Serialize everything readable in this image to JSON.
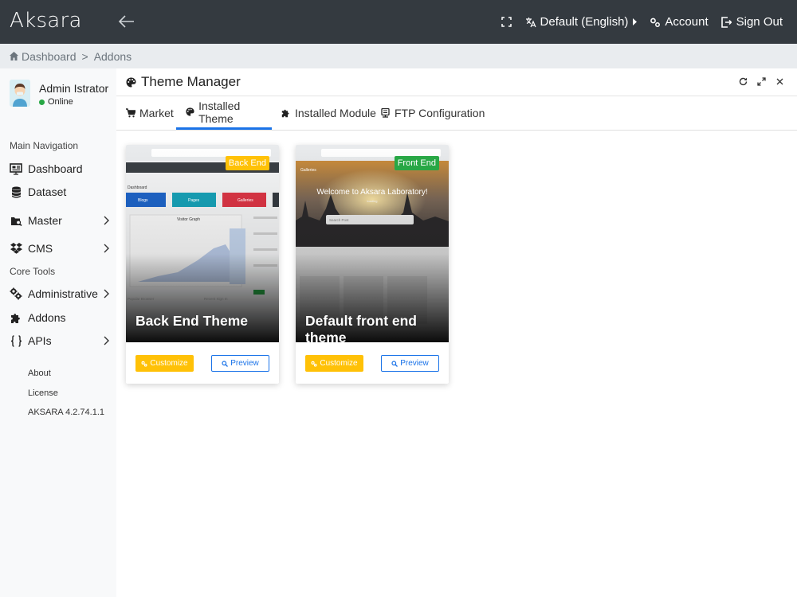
{
  "app": {
    "brand": "Aksara"
  },
  "topbar": {
    "language": "Default (English)",
    "account": "Account",
    "signout": "Sign Out"
  },
  "breadcrumb": {
    "items": [
      "Dashboard",
      "Addons"
    ]
  },
  "user": {
    "name": "Admin Istrator",
    "status": "Online"
  },
  "sidebar": {
    "main_header": "Main Navigation",
    "core_header": "Core Tools",
    "items": {
      "dashboard": "Dashboard",
      "dataset": "Dataset",
      "master": "Master",
      "cms": "CMS",
      "administrative": "Administrative",
      "addons": "Addons",
      "apis": "APIs"
    },
    "footer": {
      "about": "About",
      "license": "License",
      "version": "AKSARA 4.2.74.1.1"
    }
  },
  "panel": {
    "title": "Theme Manager"
  },
  "tabs": [
    "Market",
    "Installed Theme",
    "Installed Module",
    "FTP Configuration"
  ],
  "themes": [
    {
      "badge": "Back End",
      "badge_color": "#ffc107",
      "title": "Back End Theme",
      "customize_label": "Customize",
      "preview_label": "Preview",
      "thumb": {
        "heading": "Dashboard",
        "tiles": [
          "Blogs",
          "Pages",
          "Galleries"
        ],
        "graph_title": "Visitor Graph",
        "popular_label": "Popular Browser",
        "recent_label": "Recent Sign In"
      }
    },
    {
      "badge": "Front End",
      "badge_color": "#28a745",
      "title": "Default front end theme",
      "customize_label": "Customize",
      "preview_label": "Preview",
      "thumb": {
        "nav": "Galleries",
        "hero": "Welcome to Aksara Laboratory!",
        "hero_sub": "loading",
        "search_placeholder": "Search Post"
      }
    }
  ],
  "colors": {
    "accent": "#1a73e8",
    "topbar": "#343a40",
    "online": "#28a745"
  }
}
